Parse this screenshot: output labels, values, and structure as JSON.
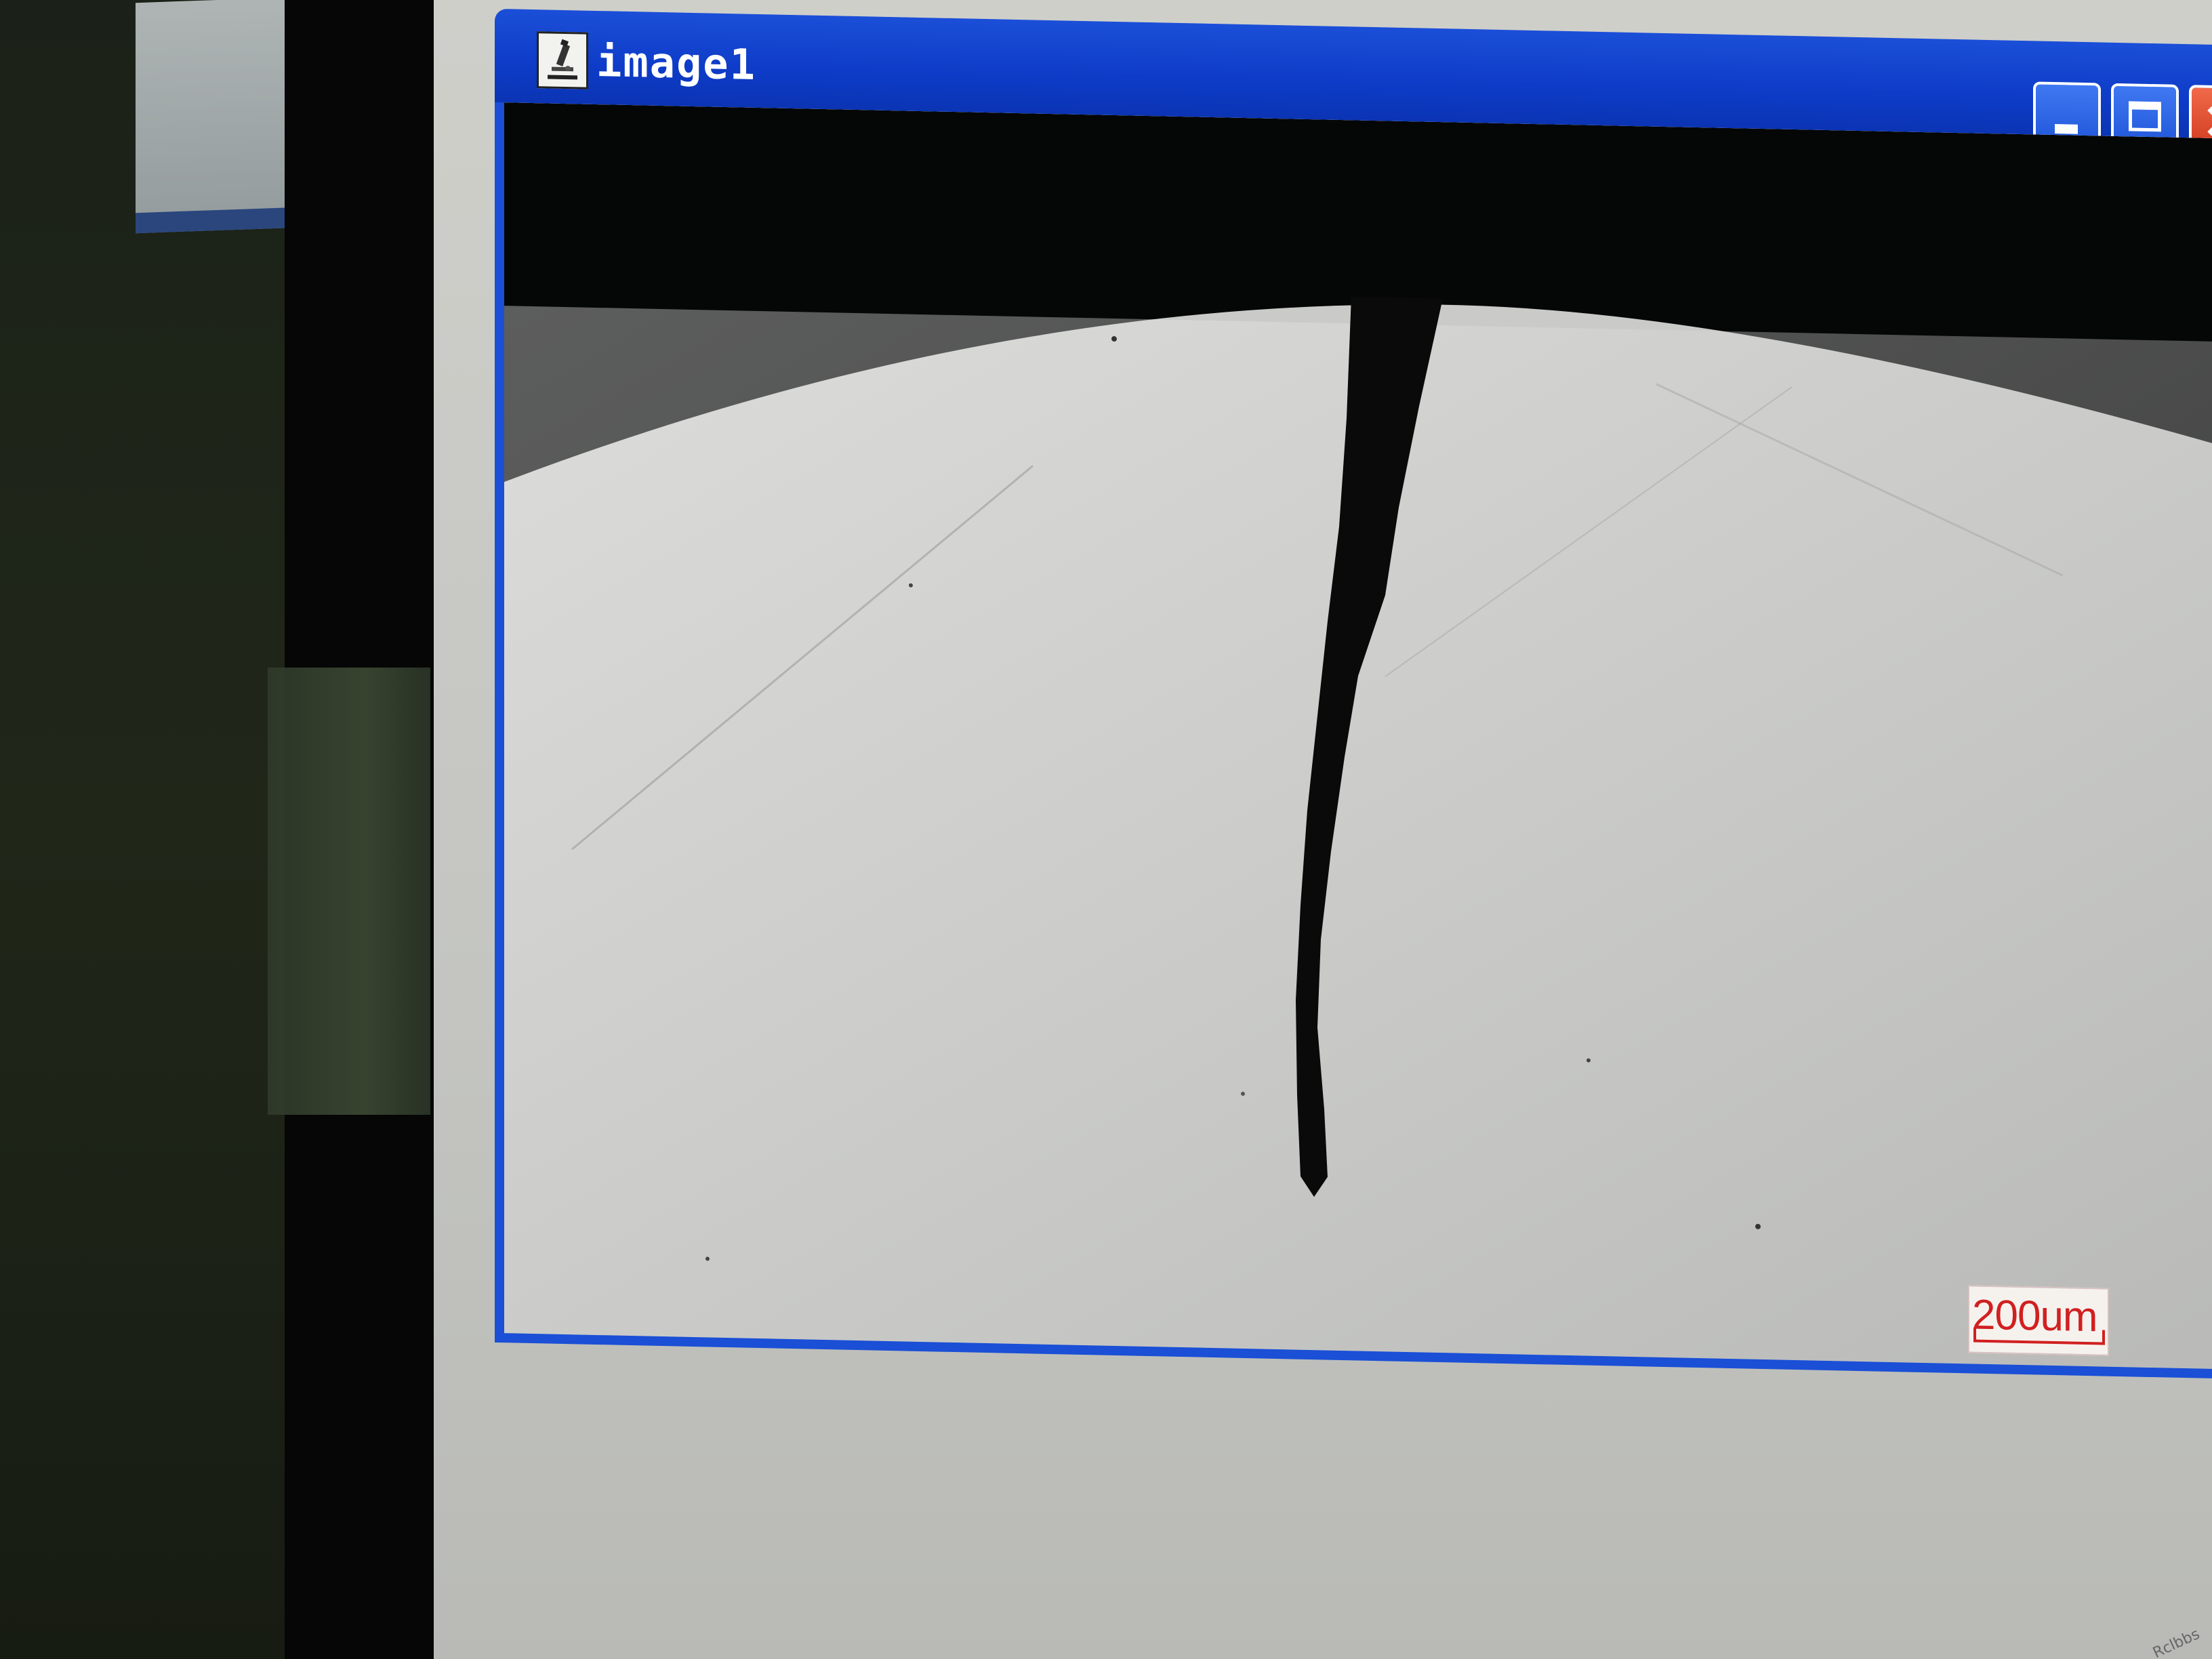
{
  "window": {
    "title": "image1",
    "icon": "microscope-icon",
    "controls": {
      "minimize": "minimize-icon",
      "maximize": "maximize-icon",
      "close": "close-icon",
      "close_glyph": "×"
    }
  },
  "viewer": {
    "scale_bar_label": "200um"
  },
  "colors": {
    "titlebar_blue": "#0e3cc8",
    "frame_blue": "#1a4fd6",
    "close_red": "#d13a1f",
    "scale_red": "#d12020",
    "specimen_gray": "#cacbc8",
    "crack_black": "#0a0a0a"
  },
  "watermark": "Rclbbs"
}
